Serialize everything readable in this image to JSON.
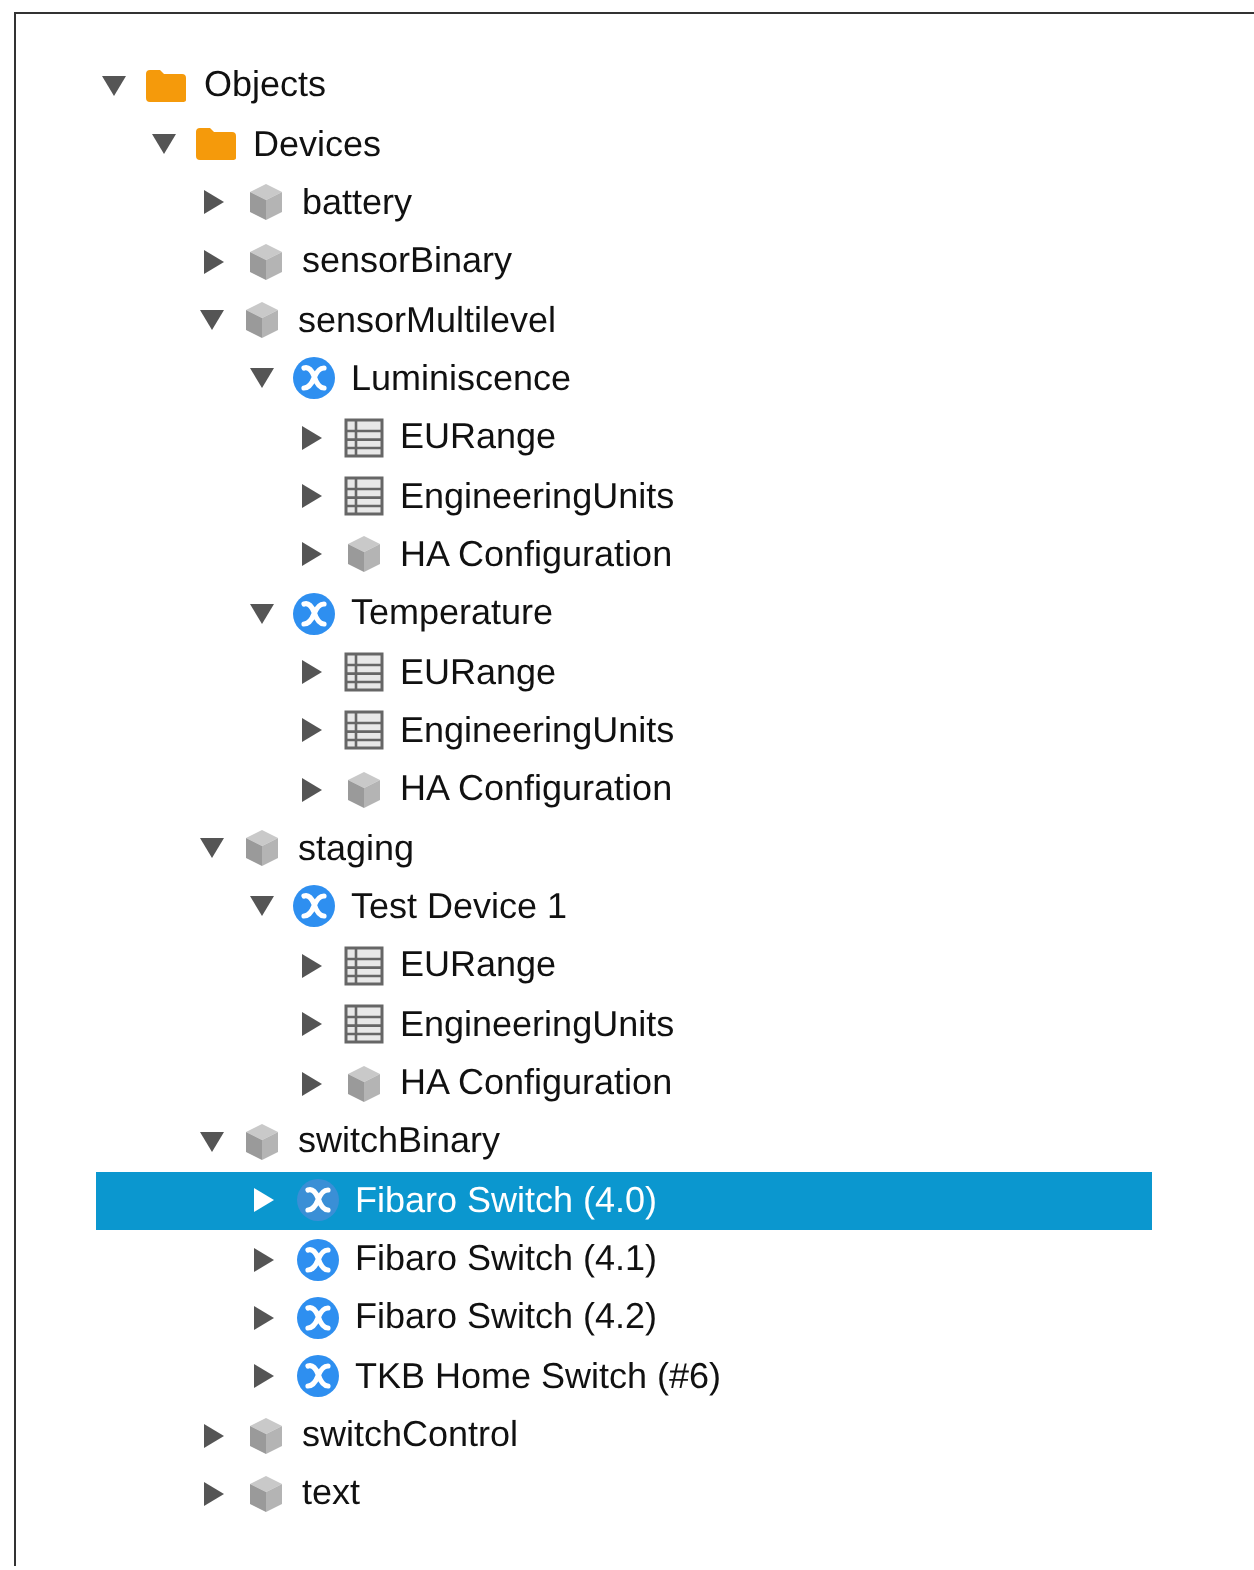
{
  "tree": [
    {
      "label": "Objects",
      "kind": "folder",
      "expanded": true,
      "selected": false,
      "children": [
        {
          "label": "Devices",
          "kind": "folder",
          "expanded": true,
          "selected": false,
          "children": [
            {
              "label": "battery",
              "kind": "cube",
              "expanded": false,
              "selected": false
            },
            {
              "label": "sensorBinary",
              "kind": "cube",
              "expanded": false,
              "selected": false
            },
            {
              "label": "sensorMultilevel",
              "kind": "cube",
              "expanded": true,
              "selected": false,
              "children": [
                {
                  "label": "Luminiscence",
                  "kind": "node",
                  "expanded": true,
                  "selected": false,
                  "children": [
                    {
                      "label": "EURange",
                      "kind": "table",
                      "expanded": false,
                      "selected": false
                    },
                    {
                      "label": "EngineeringUnits",
                      "kind": "table",
                      "expanded": false,
                      "selected": false
                    },
                    {
                      "label": "HA Configuration",
                      "kind": "cube",
                      "expanded": false,
                      "selected": false
                    }
                  ]
                },
                {
                  "label": "Temperature",
                  "kind": "node",
                  "expanded": true,
                  "selected": false,
                  "children": [
                    {
                      "label": "EURange",
                      "kind": "table",
                      "expanded": false,
                      "selected": false
                    },
                    {
                      "label": "EngineeringUnits",
                      "kind": "table",
                      "expanded": false,
                      "selected": false
                    },
                    {
                      "label": "HA Configuration",
                      "kind": "cube",
                      "expanded": false,
                      "selected": false
                    }
                  ]
                }
              ]
            },
            {
              "label": "staging",
              "kind": "cube",
              "expanded": true,
              "selected": false,
              "children": [
                {
                  "label": "Test Device 1",
                  "kind": "node",
                  "expanded": true,
                  "selected": false,
                  "children": [
                    {
                      "label": "EURange",
                      "kind": "table",
                      "expanded": false,
                      "selected": false
                    },
                    {
                      "label": "EngineeringUnits",
                      "kind": "table",
                      "expanded": false,
                      "selected": false
                    },
                    {
                      "label": "HA Configuration",
                      "kind": "cube",
                      "expanded": false,
                      "selected": false
                    }
                  ]
                }
              ]
            },
            {
              "label": "switchBinary",
              "kind": "cube",
              "expanded": true,
              "selected": false,
              "children": [
                {
                  "label": "Fibaro Switch (4.0)",
                  "kind": "node",
                  "expanded": false,
                  "selected": true
                },
                {
                  "label": "Fibaro Switch (4.1)",
                  "kind": "node",
                  "expanded": false,
                  "selected": false
                },
                {
                  "label": "Fibaro Switch (4.2)",
                  "kind": "node",
                  "expanded": false,
                  "selected": false
                },
                {
                  "label": "TKB Home Switch (#6)",
                  "kind": "node",
                  "expanded": false,
                  "selected": false
                }
              ]
            },
            {
              "label": "switchControl",
              "kind": "cube",
              "expanded": false,
              "selected": false
            },
            {
              "label": "text",
              "kind": "cube",
              "expanded": false,
              "selected": false
            }
          ]
        }
      ]
    }
  ]
}
